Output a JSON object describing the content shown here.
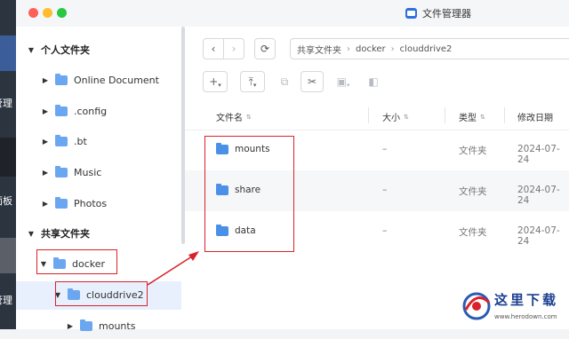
{
  "window": {
    "title": "文件管理器"
  },
  "desktop": {
    "fragments": [
      "管理",
      "面板",
      "管理"
    ]
  },
  "sidebar": {
    "personal_section": "个人文件夹",
    "personal_items": [
      {
        "label": "Online Document",
        "icon": "folder-icon"
      },
      {
        "label": ".config",
        "icon": "folder-icon"
      },
      {
        "label": ".bt",
        "icon": "folder-icon"
      },
      {
        "label": "Music",
        "icon": "music-folder-icon"
      },
      {
        "label": "Photos",
        "icon": "photo-folder-icon"
      }
    ],
    "shared_section": "共享文件夹",
    "shared_items": [
      {
        "label": "docker",
        "icon": "shared-folder-icon",
        "expanded": true
      },
      {
        "label": "clouddrive2",
        "icon": "folder-icon",
        "expanded": true,
        "selected": true
      },
      {
        "label": "mounts",
        "icon": "folder-icon"
      }
    ]
  },
  "toolbar": {
    "back": "‹",
    "forward": "›",
    "refresh": "⟳",
    "breadcrumb": [
      "共享文件夹",
      "docker",
      "clouddrive2"
    ],
    "separator": "›",
    "new": "+",
    "upload": "⤒",
    "copy": "⧉",
    "cut": "✂",
    "compress": "▣",
    "move": "◧"
  },
  "table": {
    "headers": {
      "name": "文件名",
      "size": "大小",
      "type": "类型",
      "modified": "修改日期"
    },
    "rows": [
      {
        "name": "mounts",
        "size": "–",
        "type": "文件夹",
        "modified": "2024-07-24"
      },
      {
        "name": "share",
        "size": "–",
        "type": "文件夹",
        "modified": "2024-07-24"
      },
      {
        "name": "data",
        "size": "–",
        "type": "文件夹",
        "modified": "2024-07-24"
      }
    ]
  },
  "watermark": {
    "text": "这里下载",
    "url": "www.herodown.com"
  },
  "colors": {
    "accent": "#2f6fe0",
    "highlight": "#d8232a",
    "folder": "#6aa7f0",
    "selected_bg": "#e8f0fd"
  }
}
